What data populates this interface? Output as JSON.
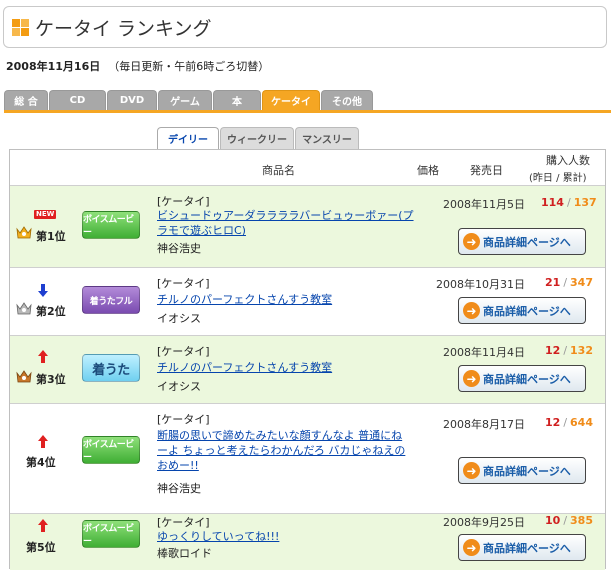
{
  "header": {
    "title": "ケータイ ランキング"
  },
  "update": {
    "date": "2008年11月16日",
    "note": "（毎日更新・午前6時ごろ切替）"
  },
  "category_tabs": [
    {
      "label": "総 合"
    },
    {
      "label": "CD"
    },
    {
      "label": "DVD"
    },
    {
      "label": "ゲーム"
    },
    {
      "label": "本"
    },
    {
      "label": "ケータイ"
    },
    {
      "label": "その他"
    }
  ],
  "active_category": "ケータイ",
  "period_tabs": [
    {
      "label": "デイリー"
    },
    {
      "label": "ウィークリー"
    },
    {
      "label": "マンスリー"
    }
  ],
  "active_period": "デイリー",
  "table_headers": {
    "product": "商品名",
    "price": "価格",
    "release": "発売日",
    "buyers": "購入人数",
    "buyers_sub": "(昨日 / 累計)"
  },
  "detail_button_label": "商品詳細ページへ",
  "colors": {
    "accent": "#f5a623",
    "row_green": "#ecf8dd",
    "link": "#0645ad",
    "daily": "#d02020",
    "total": "#f08c1a"
  },
  "rows": [
    {
      "rank": "第1位",
      "badge": "NEW",
      "rank_icon": "crown-icon",
      "thumb_label": "ボイスムービー",
      "category": "[ケータイ]",
      "title": "ビシュードゥアーダララララバービュゥーボァー(プラモで遊ぶヒロC)",
      "artist": "神谷浩史",
      "date": "2008年11月5日",
      "daily": "114",
      "total": "137"
    },
    {
      "rank": "第2位",
      "rank_icon": "arrow-down-icon",
      "thumb_label": "着うたフル",
      "category": "[ケータイ]",
      "title": "チルノのパーフェクトさんすう教室",
      "artist": "イオシス",
      "date": "2008年10月31日",
      "daily": "21",
      "total": "347"
    },
    {
      "rank": "第3位",
      "rank_icon": "arrow-up-icon",
      "thumb_label": "着うた",
      "category": "[ケータイ]",
      "title": "チルノのパーフェクトさんすう教室",
      "artist": "イオシス",
      "date": "2008年11月4日",
      "daily": "12",
      "total": "132"
    },
    {
      "rank": "第4位",
      "rank_icon": "arrow-up-icon",
      "thumb_label": "ボイスムービー",
      "category": "[ケータイ]",
      "title": "断腸の思いで諦めたみたいな顔すんなよ 普通にねーよ ちょっと考えたらわかんだろ バカじゃねえのおめー!!",
      "artist": "神谷浩史",
      "date": "2008年8月17日",
      "daily": "12",
      "total": "644"
    },
    {
      "rank": "第5位",
      "rank_icon": "arrow-up-icon",
      "thumb_label": "ボイスムービー",
      "category": "[ケータイ]",
      "title": "ゆっくりしていってね!!!",
      "artist": "棒歌ロイド",
      "date": "2008年9月25日",
      "daily": "10",
      "total": "385"
    }
  ]
}
